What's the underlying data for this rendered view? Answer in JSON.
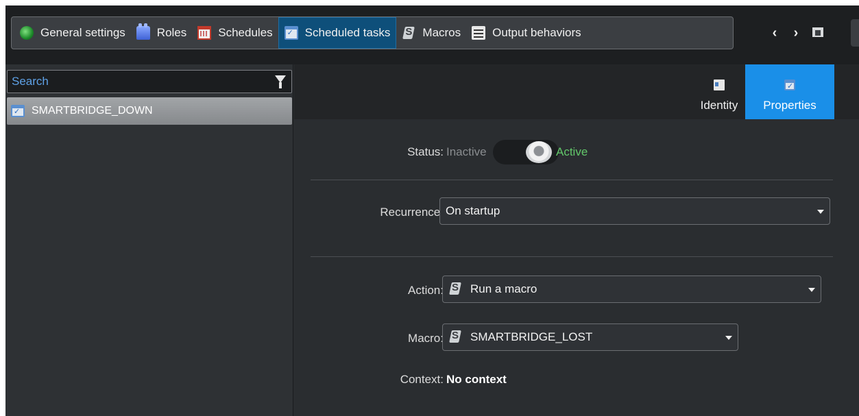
{
  "toolbar": {
    "tabs": [
      {
        "label": "General settings",
        "icon": "globe-icon"
      },
      {
        "label": "Roles",
        "icon": "roles-icon"
      },
      {
        "label": "Schedules",
        "icon": "calendar-icon"
      },
      {
        "label": "Scheduled tasks",
        "icon": "scheduled-task-icon",
        "active": true
      },
      {
        "label": "Macros",
        "icon": "macro-icon"
      },
      {
        "label": "Output behaviors",
        "icon": "output-behavior-icon"
      }
    ],
    "nav": {
      "back": "‹",
      "forward": "›"
    }
  },
  "sidebar": {
    "search_placeholder": "Search",
    "items": [
      {
        "label": "SMARTBRIDGE_DOWN",
        "selected": true
      }
    ]
  },
  "detail": {
    "tabs": [
      {
        "label": "Identity",
        "icon": "identity-icon"
      },
      {
        "label": "Properties",
        "icon": "properties-icon",
        "active": true
      }
    ],
    "status": {
      "label": "Status:",
      "off_label": "Inactive",
      "on_label": "Active",
      "value": "Active"
    },
    "recurrence": {
      "label": "Recurrence:",
      "value": "On startup"
    },
    "action": {
      "label": "Action:",
      "value": "Run a macro"
    },
    "macro": {
      "label": "Macro:",
      "value": "SMARTBRIDGE_LOST"
    },
    "context": {
      "label": "Context:",
      "value": "No context"
    }
  },
  "colors": {
    "accent": "#1a8fe8",
    "active_tab": "#0e4f7a",
    "active_status": "#62c76a",
    "background": "#2a2d30"
  }
}
